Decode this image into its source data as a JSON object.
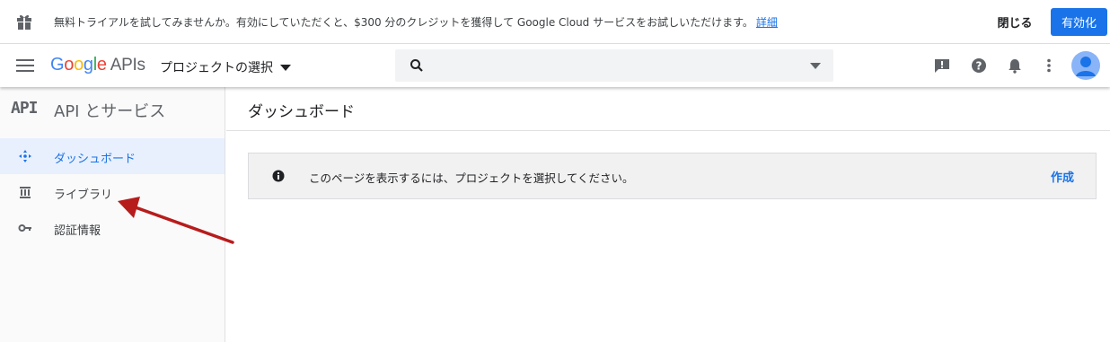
{
  "banner": {
    "message": "無料トライアルを試してみませんか。有効にしていただくと、$300 分のクレジットを獲得して Google Cloud サービスをお試しいただけます。",
    "details_link": "詳細",
    "close_label": "閉じる",
    "activate_label": "有効化"
  },
  "header": {
    "logo_google": "Google",
    "logo_apis": "APIs",
    "project_selector": "プロジェクトの選択"
  },
  "sidebar": {
    "api_badge": "API",
    "title": "API とサービス",
    "items": [
      {
        "label": "ダッシュボード",
        "icon": "dashboard-icon",
        "active": true
      },
      {
        "label": "ライブラリ",
        "icon": "library-icon",
        "active": false
      },
      {
        "label": "認証情報",
        "icon": "key-icon",
        "active": false
      }
    ]
  },
  "main": {
    "title": "ダッシュボード",
    "notice_text": "このページを表示するには、プロジェクトを選択してください。",
    "create_label": "作成"
  },
  "colors": {
    "accent": "#1a73e8",
    "arrow": "#b71c1c"
  }
}
